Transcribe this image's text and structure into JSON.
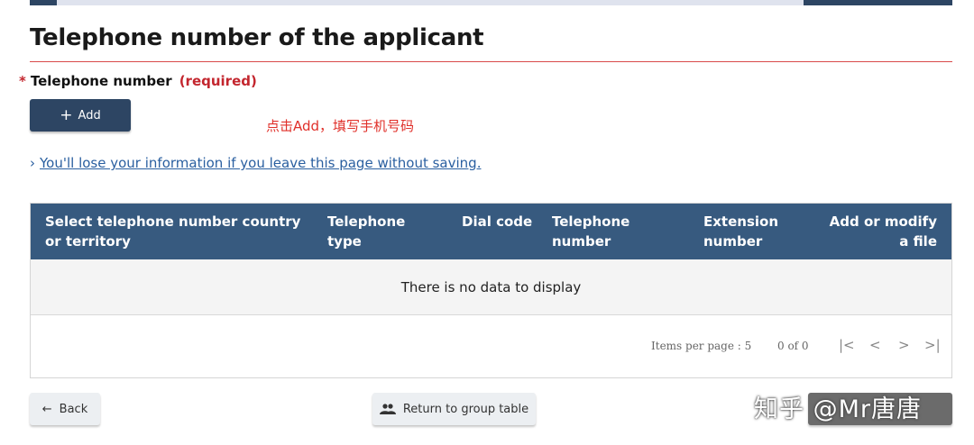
{
  "page": {
    "title": "Telephone number of the applicant"
  },
  "field": {
    "required_star": "*",
    "label": "Telephone number",
    "required_text": "(required)"
  },
  "add_button": {
    "label": "Add"
  },
  "annotation": "点击Add，填写手机号码",
  "warning_link": "You'll lose your information if you leave this page without saving.",
  "table": {
    "headers": [
      "Select telephone number country or territory",
      "Telephone type",
      "Dial code",
      "Telephone number",
      "Extension number",
      "Add or modify a file"
    ],
    "empty_message": "There is no data to display",
    "pagination": {
      "items_per_page_label": "Items per page :",
      "items_per_page_value": "5",
      "range": "0 of 0",
      "first": "|<",
      "prev": "<",
      "next": ">",
      "last": ">|"
    }
  },
  "buttons": {
    "back": "Back",
    "return_to_group": "Return to group table"
  },
  "watermark": "知乎 @Mr唐唐"
}
